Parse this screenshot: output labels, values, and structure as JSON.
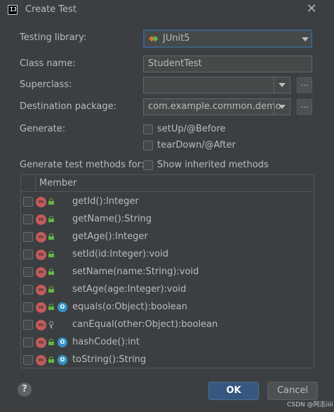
{
  "window": {
    "title": "Create Test",
    "app_icon_text": "IJ"
  },
  "form": {
    "testing_library_label": "Testing library:",
    "testing_library_value": "JUnit5",
    "class_name_label": "Class name:",
    "class_name_value": "StudentTest",
    "superclass_label": "Superclass:",
    "superclass_value": "",
    "destination_label": "Destination package:",
    "destination_value": "com.example.common.demo",
    "generate_label": "Generate:",
    "setup_label": "setUp/@Before",
    "teardown_label": "tearDown/@After",
    "generate_methods_label": "Generate test methods for:",
    "show_inherited_label": "Show inherited methods",
    "browse_label": "..."
  },
  "table": {
    "header": "Member",
    "rows": [
      {
        "name": "getId():Integer",
        "access": "public",
        "override": false
      },
      {
        "name": "getName():String",
        "access": "public",
        "override": false
      },
      {
        "name": "getAge():Integer",
        "access": "public",
        "override": false
      },
      {
        "name": "setId(id:Integer):void",
        "access": "public",
        "override": false
      },
      {
        "name": "setName(name:String):void",
        "access": "public",
        "override": false
      },
      {
        "name": "setAge(age:Integer):void",
        "access": "public",
        "override": false
      },
      {
        "name": "equals(o:Object):boolean",
        "access": "public",
        "override": true
      },
      {
        "name": "canEqual(other:Object):boolean",
        "access": "protected",
        "override": false
      },
      {
        "name": "hashCode():int",
        "access": "public",
        "override": true
      },
      {
        "name": "toString():String",
        "access": "public",
        "override": true
      }
    ]
  },
  "buttons": {
    "help": "?",
    "ok": "OK",
    "cancel": "Cancel"
  },
  "watermark": "CSDN @阿志iiii",
  "colors": {
    "accent": "#365880",
    "method_icon": "#c55a5a",
    "public_lock": "#62b543",
    "override_icon": "#3592c4"
  }
}
